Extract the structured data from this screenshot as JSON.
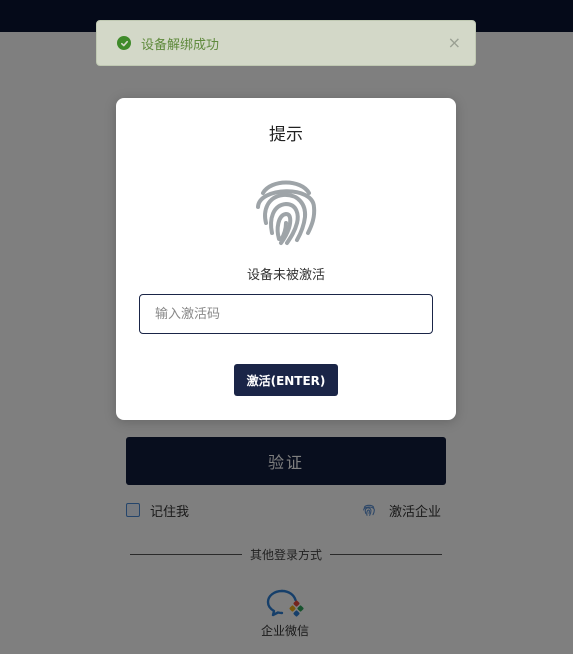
{
  "toast": {
    "message": "设备解绑成功",
    "close_symbol": "×",
    "status_color": "#3f8a2a"
  },
  "modal": {
    "title": "提示",
    "status": "设备未被激活",
    "input_placeholder": "输入激活码",
    "activate_label": "激活(ENTER)",
    "icon": "fingerprint-icon"
  },
  "login": {
    "verify_label": "验证",
    "remember_label": "记住我",
    "activate_company_label": "激活企业",
    "divider_text": "其他登录方式",
    "wecom_label": "企业微信"
  },
  "colors": {
    "primary": "#101c3d",
    "topbar": "#0b1533"
  }
}
